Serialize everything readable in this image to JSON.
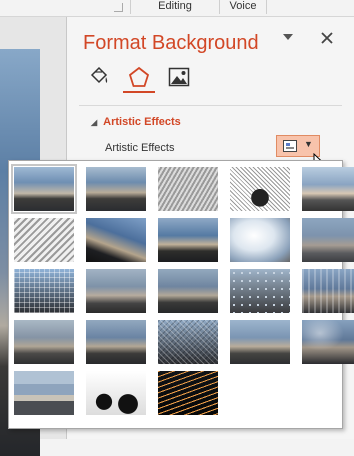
{
  "ribbon": {
    "groups": [
      "Editing",
      "Voice"
    ]
  },
  "pane": {
    "title": "Format Background",
    "menu_icon": "chevron-down-icon",
    "close_icon": "close-icon",
    "tabs": [
      {
        "icon": "fill-bucket-icon",
        "active": false
      },
      {
        "icon": "pentagon-effects-icon",
        "active": true
      },
      {
        "icon": "picture-icon",
        "active": false
      }
    ],
    "section": {
      "title": "Artistic Effects",
      "row_label": "Artistic Effects"
    }
  },
  "colors": {
    "accent": "#d24726",
    "button_highlight": "#f8c3ab"
  },
  "gallery": {
    "selected_index": 0,
    "effects": [
      {
        "style": "none"
      },
      {
        "style": "marker"
      },
      {
        "style": "pencil-grayscale"
      },
      {
        "style": "pencil-sketch"
      },
      {
        "style": "line-drawing"
      },
      {
        "style": "chalk-sketch"
      },
      {
        "style": "paint-strokes"
      },
      {
        "style": "paint-brush"
      },
      {
        "style": "glow-diffused"
      },
      {
        "style": "blur"
      },
      {
        "style": "light-screen"
      },
      {
        "style": "watercolor-sponge"
      },
      {
        "style": "film-grain"
      },
      {
        "style": "mosaic-bubbles"
      },
      {
        "style": "glass"
      },
      {
        "style": "cement"
      },
      {
        "style": "texturizer"
      },
      {
        "style": "crisscross-etching"
      },
      {
        "style": "pastels-smooth"
      },
      {
        "style": "plastic-wrap"
      },
      {
        "style": "cutout"
      },
      {
        "style": "photocopy"
      },
      {
        "style": "glow-edges"
      }
    ]
  }
}
